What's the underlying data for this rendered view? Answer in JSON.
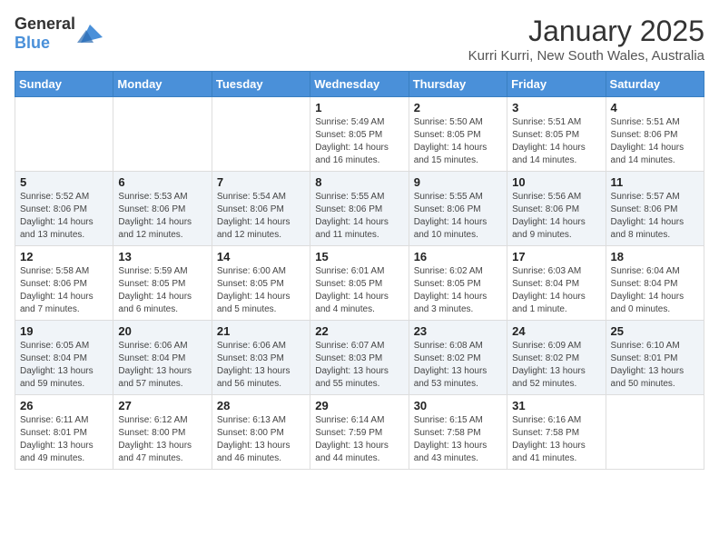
{
  "header": {
    "logo_general": "General",
    "logo_blue": "Blue",
    "month": "January 2025",
    "location": "Kurri Kurri, New South Wales, Australia"
  },
  "days_of_week": [
    "Sunday",
    "Monday",
    "Tuesday",
    "Wednesday",
    "Thursday",
    "Friday",
    "Saturday"
  ],
  "weeks": [
    [
      {
        "day": "",
        "info": ""
      },
      {
        "day": "",
        "info": ""
      },
      {
        "day": "",
        "info": ""
      },
      {
        "day": "1",
        "info": "Sunrise: 5:49 AM\nSunset: 8:05 PM\nDaylight: 14 hours\nand 16 minutes."
      },
      {
        "day": "2",
        "info": "Sunrise: 5:50 AM\nSunset: 8:05 PM\nDaylight: 14 hours\nand 15 minutes."
      },
      {
        "day": "3",
        "info": "Sunrise: 5:51 AM\nSunset: 8:05 PM\nDaylight: 14 hours\nand 14 minutes."
      },
      {
        "day": "4",
        "info": "Sunrise: 5:51 AM\nSunset: 8:06 PM\nDaylight: 14 hours\nand 14 minutes."
      }
    ],
    [
      {
        "day": "5",
        "info": "Sunrise: 5:52 AM\nSunset: 8:06 PM\nDaylight: 14 hours\nand 13 minutes."
      },
      {
        "day": "6",
        "info": "Sunrise: 5:53 AM\nSunset: 8:06 PM\nDaylight: 14 hours\nand 12 minutes."
      },
      {
        "day": "7",
        "info": "Sunrise: 5:54 AM\nSunset: 8:06 PM\nDaylight: 14 hours\nand 12 minutes."
      },
      {
        "day": "8",
        "info": "Sunrise: 5:55 AM\nSunset: 8:06 PM\nDaylight: 14 hours\nand 11 minutes."
      },
      {
        "day": "9",
        "info": "Sunrise: 5:55 AM\nSunset: 8:06 PM\nDaylight: 14 hours\nand 10 minutes."
      },
      {
        "day": "10",
        "info": "Sunrise: 5:56 AM\nSunset: 8:06 PM\nDaylight: 14 hours\nand 9 minutes."
      },
      {
        "day": "11",
        "info": "Sunrise: 5:57 AM\nSunset: 8:06 PM\nDaylight: 14 hours\nand 8 minutes."
      }
    ],
    [
      {
        "day": "12",
        "info": "Sunrise: 5:58 AM\nSunset: 8:06 PM\nDaylight: 14 hours\nand 7 minutes."
      },
      {
        "day": "13",
        "info": "Sunrise: 5:59 AM\nSunset: 8:05 PM\nDaylight: 14 hours\nand 6 minutes."
      },
      {
        "day": "14",
        "info": "Sunrise: 6:00 AM\nSunset: 8:05 PM\nDaylight: 14 hours\nand 5 minutes."
      },
      {
        "day": "15",
        "info": "Sunrise: 6:01 AM\nSunset: 8:05 PM\nDaylight: 14 hours\nand 4 minutes."
      },
      {
        "day": "16",
        "info": "Sunrise: 6:02 AM\nSunset: 8:05 PM\nDaylight: 14 hours\nand 3 minutes."
      },
      {
        "day": "17",
        "info": "Sunrise: 6:03 AM\nSunset: 8:04 PM\nDaylight: 14 hours\nand 1 minute."
      },
      {
        "day": "18",
        "info": "Sunrise: 6:04 AM\nSunset: 8:04 PM\nDaylight: 14 hours\nand 0 minutes."
      }
    ],
    [
      {
        "day": "19",
        "info": "Sunrise: 6:05 AM\nSunset: 8:04 PM\nDaylight: 13 hours\nand 59 minutes."
      },
      {
        "day": "20",
        "info": "Sunrise: 6:06 AM\nSunset: 8:04 PM\nDaylight: 13 hours\nand 57 minutes."
      },
      {
        "day": "21",
        "info": "Sunrise: 6:06 AM\nSunset: 8:03 PM\nDaylight: 13 hours\nand 56 minutes."
      },
      {
        "day": "22",
        "info": "Sunrise: 6:07 AM\nSunset: 8:03 PM\nDaylight: 13 hours\nand 55 minutes."
      },
      {
        "day": "23",
        "info": "Sunrise: 6:08 AM\nSunset: 8:02 PM\nDaylight: 13 hours\nand 53 minutes."
      },
      {
        "day": "24",
        "info": "Sunrise: 6:09 AM\nSunset: 8:02 PM\nDaylight: 13 hours\nand 52 minutes."
      },
      {
        "day": "25",
        "info": "Sunrise: 6:10 AM\nSunset: 8:01 PM\nDaylight: 13 hours\nand 50 minutes."
      }
    ],
    [
      {
        "day": "26",
        "info": "Sunrise: 6:11 AM\nSunset: 8:01 PM\nDaylight: 13 hours\nand 49 minutes."
      },
      {
        "day": "27",
        "info": "Sunrise: 6:12 AM\nSunset: 8:00 PM\nDaylight: 13 hours\nand 47 minutes."
      },
      {
        "day": "28",
        "info": "Sunrise: 6:13 AM\nSunset: 8:00 PM\nDaylight: 13 hours\nand 46 minutes."
      },
      {
        "day": "29",
        "info": "Sunrise: 6:14 AM\nSunset: 7:59 PM\nDaylight: 13 hours\nand 44 minutes."
      },
      {
        "day": "30",
        "info": "Sunrise: 6:15 AM\nSunset: 7:58 PM\nDaylight: 13 hours\nand 43 minutes."
      },
      {
        "day": "31",
        "info": "Sunrise: 6:16 AM\nSunset: 7:58 PM\nDaylight: 13 hours\nand 41 minutes."
      },
      {
        "day": "",
        "info": ""
      }
    ]
  ],
  "colors": {
    "header_bg": "#4a90d9",
    "row_shaded": "#f0f4f8",
    "row_white": "#ffffff"
  }
}
